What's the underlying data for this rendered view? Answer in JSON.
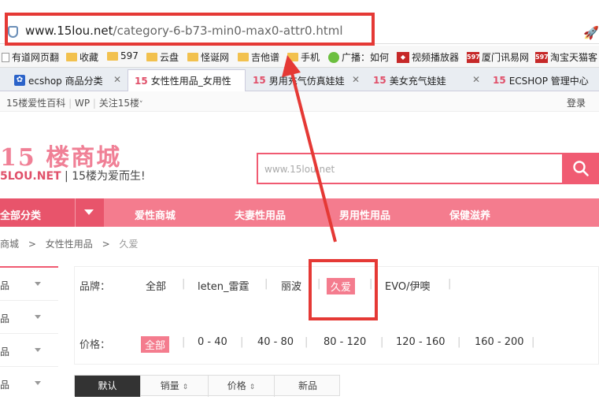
{
  "browser": {
    "url_host": "www.15lou.net",
    "url_path": "/category-6-b73-min0-max0-attr0.html",
    "bookmarks": [
      {
        "label": "有道网页翻",
        "icon": "page-icon"
      },
      {
        "label": "收藏",
        "icon": "folder-icon"
      },
      {
        "label": "597",
        "icon": "folder-icon"
      },
      {
        "label": "云盘",
        "icon": "folder-icon"
      },
      {
        "label": "怪诞网",
        "icon": "folder-icon"
      },
      {
        "label": "吉他谱",
        "icon": "folder-icon"
      },
      {
        "label": "手机",
        "icon": "folder-icon"
      },
      {
        "label": "广播：如何",
        "icon": "wechat-icon"
      },
      {
        "label": "视频播放器",
        "icon": "red-badge-icon"
      },
      {
        "label": "厦门讯易网",
        "icon": "red-badge-icon"
      },
      {
        "label": "淘宝天猫客",
        "icon": "red-badge-icon"
      }
    ],
    "red_badge_text": "597",
    "tabs": [
      {
        "label": "ecshop 商品分类"
      },
      {
        "label": "女性性用品_女用性"
      },
      {
        "label": "男用充气仿真娃娃"
      },
      {
        "label": "美女充气娃娃"
      },
      {
        "label": "ECSHOP 管理中心"
      }
    ],
    "tab_prefix": "15"
  },
  "topbar": {
    "links": [
      "15楼爱性百科",
      "WP",
      "关注15楼"
    ],
    "login": "登录"
  },
  "header": {
    "logo_text": "15 楼商城",
    "slogan_site": "5LOU.NET",
    "slogan_text": "| 15楼为爱而生!",
    "search_placeholder": "www.15lou.net"
  },
  "nav": {
    "all_categories": "全部分类",
    "items": [
      "爱性商城",
      "夫妻性用品",
      "男用性用品",
      "保健滋养"
    ]
  },
  "breadcrumb": {
    "items": [
      "商城",
      "女性性用品",
      "久爱"
    ],
    "separator": ">"
  },
  "sidebar": {
    "items": [
      "品",
      "品",
      "品",
      "品"
    ]
  },
  "filter": {
    "brand_label": "品牌：",
    "brands": [
      "全部",
      "leten_雷霆",
      "丽波",
      "久爱",
      "EVO/伊噢"
    ],
    "brand_selected": "久爱",
    "price_label": "价格：",
    "prices": [
      "全部",
      "0 - 40",
      "40 - 80",
      "80 - 120",
      "120 - 160",
      "160 - 200"
    ],
    "price_selected": "全部"
  },
  "sort": {
    "items": [
      "默认",
      "销量",
      "价格",
      "新品"
    ],
    "active": "默认"
  },
  "colors": {
    "brand_pink": "#f05b72",
    "nav_pink": "#f47c8e",
    "annotation_red": "#e53935"
  }
}
